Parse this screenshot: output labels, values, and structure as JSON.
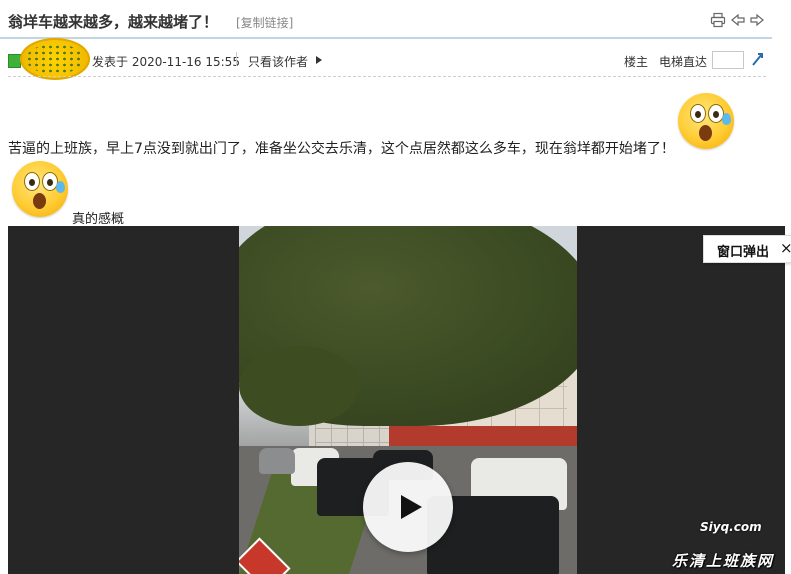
{
  "post": {
    "title": "翁垟车越来越多，越来越堵了！",
    "copy_link": "[复制链接]"
  },
  "meta": {
    "posted_at": "发表于 2020-11-16 15:55",
    "only_author": "只看该作者",
    "floor_label": "楼主",
    "elevator_label": "电梯直达",
    "floor_input_value": ""
  },
  "content": {
    "text": "苦逼的上班族，早上7点没到就出门了，准备坐公交去乐清，这个点居然都这么多车，现在翁垟都开始堵了！",
    "caption": "真的感概"
  },
  "video": {
    "popout_label": "窗口弹出",
    "popout_close": "×"
  },
  "watermark": {
    "site_name": "乐清上班族网",
    "logo_text": "Siyq.com"
  },
  "icons": {
    "print": "print-icon",
    "prev": "prev-thread-icon",
    "next": "next-thread-icon",
    "go": "go-arrow-icon",
    "play": "play-icon"
  },
  "colors": {
    "header_rule": "#c2d5e3",
    "video_bg": "#262626",
    "link_grey": "#888888"
  }
}
